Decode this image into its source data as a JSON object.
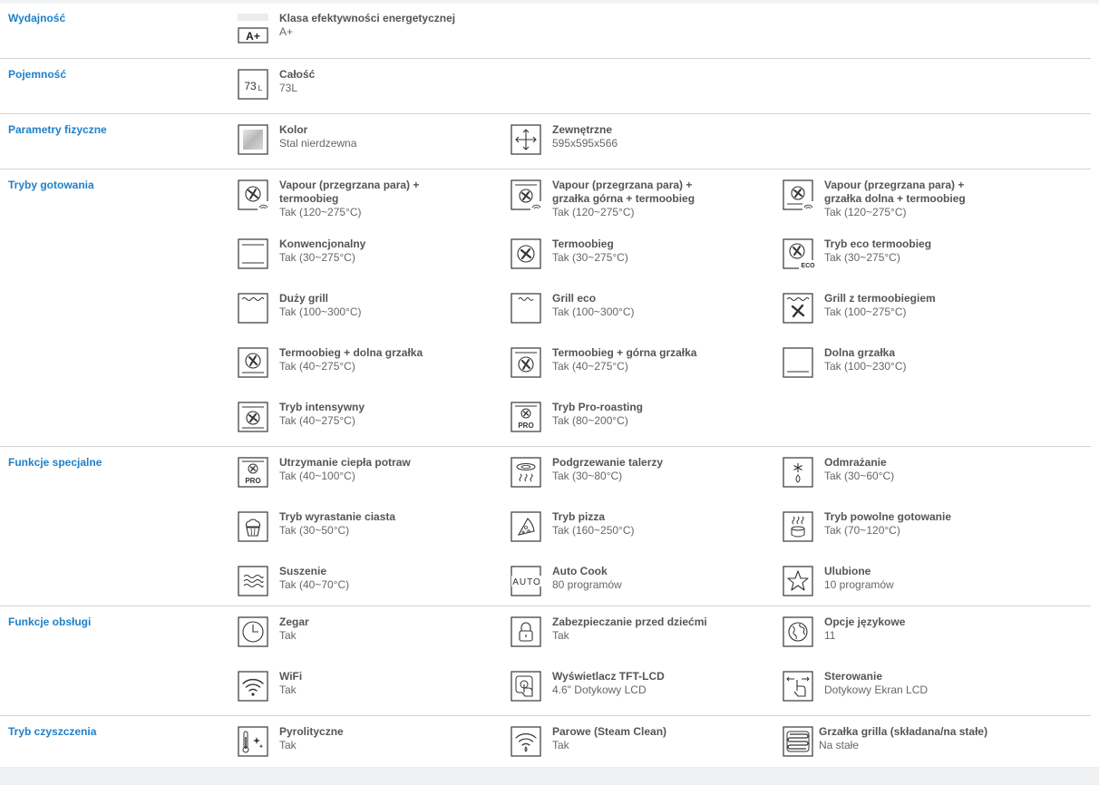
{
  "sections": [
    {
      "id": "wydajnosc",
      "title": "Wydajność",
      "items": [
        {
          "icon": "energy-class-icon",
          "name": "Klasa efektywności energetycznej",
          "value": "A+",
          "badge": "A+"
        }
      ]
    },
    {
      "id": "pojemnosc",
      "title": "Pojemność",
      "items": [
        {
          "icon": "capacity-icon",
          "name": "Całość",
          "value": "73L",
          "badge": "73L"
        }
      ]
    },
    {
      "id": "parametry",
      "title": "Parametry fizyczne",
      "items": [
        {
          "icon": "color-swatch-icon",
          "name": "Kolor",
          "value": "Stal nierdzewna"
        },
        {
          "icon": "dimensions-icon",
          "name": "Zewnętrzne",
          "value": "595x595x566"
        }
      ]
    },
    {
      "id": "tryby",
      "title": "Tryby gotowania",
      "items": [
        {
          "icon": "vapour-fan-icon",
          "name1": "Vapour (przegrzana para) +",
          "name2": "termoobieg",
          "value": "Tak (120~275°C)"
        },
        {
          "icon": "vapour-top-fan-icon",
          "name1": "Vapour (przegrzana para) +",
          "name2": "grzałka górna + termoobieg",
          "value": "Tak (120~275°C)"
        },
        {
          "icon": "vapour-bottom-fan-icon",
          "name1": "Vapour (przegrzana para) +",
          "name2": "grzałka dolna + termoobieg",
          "value": "Tak (120~275°C)"
        },
        {
          "icon": "conventional-icon",
          "name": "Konwencjonalny",
          "value": "Tak (30~275°C)"
        },
        {
          "icon": "fan-icon",
          "name": "Termoobieg",
          "value": "Tak (30~275°C)"
        },
        {
          "icon": "eco-fan-icon",
          "name": "Tryb eco termoobieg",
          "value": "Tak (30~275°C)",
          "badge": "ECO"
        },
        {
          "icon": "large-grill-icon",
          "name": "Duży grill",
          "value": "Tak (100~300°C)"
        },
        {
          "icon": "eco-grill-icon",
          "name": "Grill eco",
          "value": "Tak (100~300°C)"
        },
        {
          "icon": "grill-fan-icon",
          "name": "Grill z termoobiegiem",
          "value": "Tak (100~275°C)"
        },
        {
          "icon": "fan-bottom-heater-icon",
          "name": "Termoobieg + dolna grzałka",
          "value": "Tak (40~275°C)"
        },
        {
          "icon": "fan-top-heater-icon",
          "name": "Termoobieg + górna grzałka",
          "value": "Tak (40~275°C)"
        },
        {
          "icon": "bottom-heater-icon",
          "name": "Dolna grzałka",
          "value": "Tak (100~230°C)"
        },
        {
          "icon": "intensive-icon",
          "name": "Tryb intensywny",
          "value": "Tak (40~275°C)"
        },
        {
          "icon": "pro-roasting-icon",
          "name": "Tryb Pro-roasting",
          "value": "Tak (80~200°C)",
          "badge": "PRO"
        }
      ]
    },
    {
      "id": "specjalne",
      "title": "Funkcje specjalne",
      "items": [
        {
          "icon": "keep-warm-icon",
          "name": "Utrzymanie ciepła potraw",
          "value": "Tak (40~100°C)",
          "badge": "PRO"
        },
        {
          "icon": "plate-warming-icon",
          "name": "Podgrzewanie talerzy",
          "value": "Tak (30~80°C)"
        },
        {
          "icon": "defrost-icon",
          "name": "Odmrażanie",
          "value": "Tak (30~60°C)"
        },
        {
          "icon": "dough-proofing-icon",
          "name": "Tryb wyrastanie ciasta",
          "value": "Tak (30~50°C)"
        },
        {
          "icon": "pizza-icon",
          "name": "Tryb pizza",
          "value": "Tak (160~250°C)"
        },
        {
          "icon": "slow-cook-icon",
          "name": "Tryb powolne gotowanie",
          "value": "Tak (70~120°C)"
        },
        {
          "icon": "drying-icon",
          "name": "Suszenie",
          "value": "Tak (40~70°C)"
        },
        {
          "icon": "auto-cook-icon",
          "name": "Auto Cook",
          "value": "80 programów",
          "badge": "AUTO"
        },
        {
          "icon": "favourite-star-icon",
          "name": "Ulubione",
          "value": "10 programów"
        }
      ]
    },
    {
      "id": "obslugi",
      "title": "Funkcje obsługi",
      "items": [
        {
          "icon": "clock-icon",
          "name": "Zegar",
          "value": "Tak"
        },
        {
          "icon": "child-lock-icon",
          "name": "Zabezpieczanie przed dziećmi",
          "value": "Tak"
        },
        {
          "icon": "globe-icon",
          "name": "Opcje językowe",
          "value": "11"
        },
        {
          "icon": "wifi-icon",
          "name": "WiFi",
          "value": "Tak"
        },
        {
          "icon": "touch-display-icon",
          "name": "Wyświetlacz TFT-LCD",
          "value": "4.6\" Dotykowy LCD"
        },
        {
          "icon": "touch-control-icon",
          "name": "Sterowanie",
          "value": "Dotykowy Ekran LCD"
        }
      ]
    },
    {
      "id": "czyszczenie",
      "title": "Tryb czyszczenia",
      "items": [
        {
          "icon": "pyrolytic-icon",
          "name": "Pyrolityczne",
          "value": "Tak"
        },
        {
          "icon": "steam-clean-icon",
          "name": "Parowe (Steam Clean)",
          "value": "Tak"
        },
        {
          "icon": "grill-heater-icon",
          "name": "Grzałka grilla (składana/na stałe)",
          "value": "Na stałe"
        }
      ]
    }
  ]
}
